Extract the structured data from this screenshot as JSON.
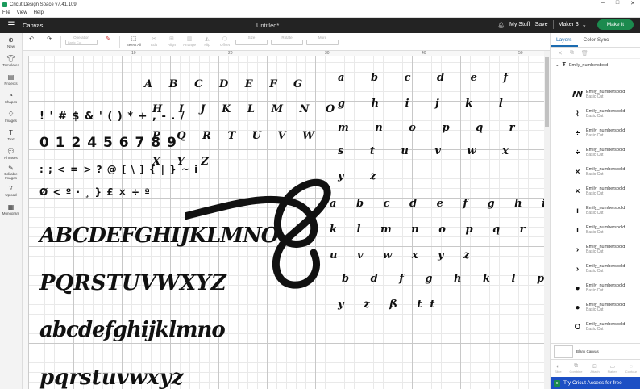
{
  "window": {
    "title": "Cricut Design Space  v7.41.109",
    "controls": [
      "–",
      "□",
      "✕"
    ]
  },
  "menu": [
    "File",
    "View",
    "Help"
  ],
  "topbar": {
    "section": "Canvas",
    "doc_title": "Untitled*",
    "my_stuff": "My Stuff",
    "save": "Save",
    "machine": "Maker 3",
    "make_it": "Make It"
  },
  "toolbar": {
    "operation_label": "Operation",
    "operation_value": "Basic Cut",
    "select_all": "Select All",
    "edit": "Edit",
    "align": "Align",
    "arrange": "Arrange",
    "flip": "Flip",
    "offset": "Offset",
    "size": "Size",
    "rotate": "Rotate",
    "more": "More"
  },
  "leftnav": [
    {
      "label": "New",
      "icon": "plus-icon"
    },
    {
      "label": "Templates",
      "icon": "shirt-icon"
    },
    {
      "label": "Projects",
      "icon": "folder-icon"
    },
    {
      "label": "Shapes",
      "icon": "shapes-icon"
    },
    {
      "label": "Images",
      "icon": "bulb-icon"
    },
    {
      "label": "Text",
      "icon": "text-icon"
    },
    {
      "label": "Phrases",
      "icon": "speech-icon"
    },
    {
      "label": "Editable Images",
      "icon": "editable-icon"
    },
    {
      "label": "Upload",
      "icon": "upload-icon"
    },
    {
      "label": "Monogram",
      "icon": "monogram-icon"
    }
  ],
  "ruler": [
    "10",
    "20",
    "30",
    "40",
    "50"
  ],
  "canvas_art": {
    "upper_caps": [
      "A B C D E F G",
      "H I J K L M N O",
      "P Q R   T U V W",
      "X Y Z"
    ],
    "symbols": [
      "! ' # $ & ' ( ) * + , - . /",
      "0 1 2 4 5 6 7 8 9",
      ": ; < = > ? @ [ \\ ] { | } ~ i",
      "Ø < º · ¸ } £ × ÷ ª"
    ],
    "big_caps_1": "ABCDEFGHIJKLMNO",
    "big_caps_2": "PQRSTUVWXYZ",
    "big_lower_1": "abcdefghijklmno",
    "big_lower_2": "pqrstuvwxyz",
    "large_glyph": "S",
    "lower_tails": [
      "a b c d e f",
      "g h i j k l",
      "m n o p q r",
      "s t u v w x",
      "y z"
    ],
    "lower_tails_2": [
      "a b c d e f g h i j",
      "k l m n o p q r s t",
      "u v w x y z"
    ],
    "lower_tails_3": [
      "b d f g h k l p q t",
      "y z ß tt"
    ]
  },
  "layers_panel": {
    "tabs": [
      "Layers",
      "Color Sync"
    ],
    "group_name": "Emily_numbersbold",
    "layers": [
      {
        "name": "Emily_numbersbold",
        "type": "Basic Cut",
        "glyph": "ꟿ"
      },
      {
        "name": "Emily_numbersbold",
        "type": "Basic Cut",
        "glyph": "⌇"
      },
      {
        "name": "Emily_numbersbold",
        "type": "Basic Cut",
        "glyph": "÷"
      },
      {
        "name": "Emily_numbersbold",
        "type": "Basic Cut",
        "glyph": "÷"
      },
      {
        "name": "Emily_numbersbold",
        "type": "Basic Cut",
        "glyph": "×"
      },
      {
        "name": "Emily_numbersbold",
        "type": "Basic Cut",
        "glyph": "×"
      },
      {
        "name": "Emily_numbersbold",
        "type": "Basic Cut",
        "glyph": "ı"
      },
      {
        "name": "Emily_numbersbold",
        "type": "Basic Cut",
        "glyph": "ı"
      },
      {
        "name": "Emily_numbersbold",
        "type": "Basic Cut",
        "glyph": "›"
      },
      {
        "name": "Emily_numbersbold",
        "type": "Basic Cut",
        "glyph": "›"
      },
      {
        "name": "Emily_numbersbold",
        "type": "Basic Cut",
        "glyph": "●"
      },
      {
        "name": "Emily_numbersbold",
        "type": "Basic Cut",
        "glyph": "●"
      },
      {
        "name": "Emily_numbersbold",
        "type": "Basic Cut",
        "glyph": "O"
      }
    ],
    "blank_canvas": "Blank Canvas",
    "bottom_tools": [
      "Slice",
      "Combine",
      "Attach",
      "Flatten",
      "Contour"
    ],
    "promo": "Try Cricut Access for free"
  }
}
